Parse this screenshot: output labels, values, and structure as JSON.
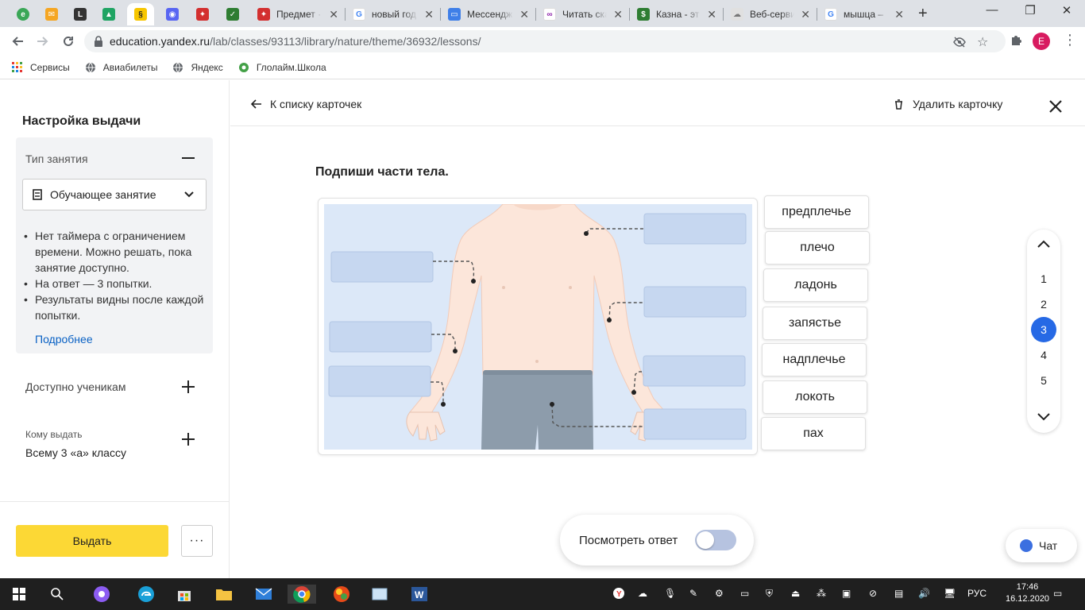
{
  "browser": {
    "tabs": [
      {
        "title": "",
        "icon": "greenchat-icon",
        "color": "#3aa757"
      },
      {
        "title": "",
        "icon": "mail-icon",
        "color": "#f5a623"
      },
      {
        "title": "",
        "icon": "litres-icon",
        "color": "#333333"
      },
      {
        "title": "",
        "icon": "drive-icon",
        "color": "#1fa463"
      },
      {
        "title": "",
        "icon": "yaklass-icon",
        "color": "#f7c600"
      },
      {
        "title": "",
        "icon": "discord-icon",
        "color": "#5865f2"
      },
      {
        "title": "",
        "icon": "gerb-icon",
        "color": "#d32f2f"
      },
      {
        "title": "",
        "icon": "check-icon",
        "color": "#2e7d32"
      },
      {
        "title": "Предмет ·",
        "icon": "gerb-icon",
        "color": "#d32f2f"
      },
      {
        "title": "новый год",
        "icon": "google-icon",
        "color": "#4285f4"
      },
      {
        "title": "Мессендж",
        "icon": "messenger-icon",
        "color": "#3f7fe8"
      },
      {
        "title": "Читать ска",
        "icon": "book-icon",
        "color": "#8e24aa"
      },
      {
        "title": "Казна - эт",
        "icon": "money-icon",
        "color": "#2e7d32"
      },
      {
        "title": "Веб-серви",
        "icon": "cloud-icon",
        "color": "#9e9e9e"
      },
      {
        "title": "мышца –",
        "icon": "google-icon",
        "color": "#4285f4"
      }
    ],
    "url_host": "education.yandex.ru",
    "url_path": "/lab/classes/93113/library/nature/theme/36932/lessons/",
    "profile_initial": "E",
    "bookmarks": [
      {
        "label": "Сервисы",
        "icon": "apps-grid-icon"
      },
      {
        "label": "Авиабилеты",
        "icon": "globe-icon"
      },
      {
        "label": "Яндекс",
        "icon": "globe-icon"
      },
      {
        "label": "Глолайм.Школа",
        "icon": "school-icon"
      }
    ]
  },
  "settings": {
    "title": "Настройка выдачи",
    "type_label": "Тип занятия",
    "type_value": "Обучающее занятие",
    "rules": [
      "Нет таймера с ограничением времени. Можно решать, пока занятие доступно.",
      "На ответ — 3 попытки.",
      "Результаты видны после каждой попытки."
    ],
    "more_link": "Подробнее",
    "available_label": "Доступно ученикам",
    "whom_label": "Кому выдать",
    "whom_value": "Всему 3 «а» классу",
    "issue_button": "Выдать",
    "more_button": "···"
  },
  "main": {
    "back_label": "К списку карточек",
    "delete_label": "Удалить карточку",
    "task_title": "Подпиши части тела.",
    "words": [
      "предплечье",
      "плечо",
      "ладонь",
      "запястье",
      "надплечье",
      "локоть",
      "пах"
    ],
    "pages": [
      "1",
      "2",
      "3",
      "4",
      "5"
    ],
    "current_page": "3",
    "answer_label": "Посмотреть ответ",
    "chat_label": "Чат"
  },
  "taskbar": {
    "lang": "РУС",
    "time": "17:46",
    "date": "16.12.2020"
  },
  "colors": {
    "accent": "#2669e5",
    "issue_button": "#fcd835",
    "figure_bg": "#dce8f8",
    "skin": "#fce6da",
    "pants": "#8d9cab",
    "label_box": "#c6d7f0"
  }
}
